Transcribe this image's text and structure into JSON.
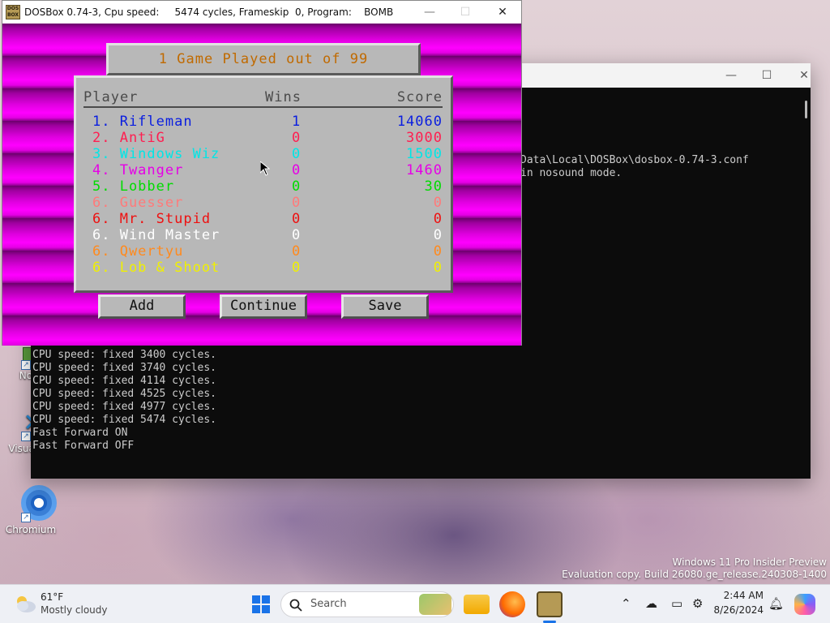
{
  "desktop": {
    "icons": [
      {
        "label": "Note"
      },
      {
        "label": "Visual Co"
      },
      {
        "label": "Chromium"
      }
    ],
    "watermark": {
      "line1": "Windows 11 Pro Insider Preview",
      "line2": "Evaluation copy. Build 26080.ge_release.240308-1400"
    }
  },
  "console": {
    "top_lines": [
      "Data\\Local\\DOSBox\\dosbox-0.74-3.conf",
      "in nosound mode."
    ],
    "lines": [
      "CPU speed: fixed 3400 cycles.",
      "CPU speed: fixed 3740 cycles.",
      "CPU speed: fixed 4114 cycles.",
      "CPU speed: fixed 4525 cycles.",
      "CPU speed: fixed 4977 cycles.",
      "CPU speed: fixed 5474 cycles.",
      "Fast Forward ON",
      "Fast Forward OFF"
    ]
  },
  "dosbox": {
    "title": "DOSBox 0.74-3, Cpu speed:     5474 cycles, Frameskip  0, Program:    BOMB",
    "logo_text": "DOS BOX",
    "game": {
      "header": "1 Game Played out of 99",
      "columns": {
        "player": "Player",
        "wins": "Wins",
        "score": "Score"
      },
      "rows": [
        {
          "player": "1. Rifleman",
          "wins": "1",
          "score": "14060",
          "color": "#0a1ee0"
        },
        {
          "player": "2. AntiG",
          "wins": "0",
          "score": "3000",
          "color": "#ff1e50"
        },
        {
          "player": "3. Windows Wiz",
          "wins": "0",
          "score": "1500",
          "color": "#00e6e6"
        },
        {
          "player": "4. Twanger",
          "wins": "0",
          "score": "1460",
          "color": "#e600e6"
        },
        {
          "player": "5. Lobber",
          "wins": "0",
          "score": "30",
          "color": "#00dc00"
        },
        {
          "player": "6. Guesser",
          "wins": "0",
          "score": "0",
          "color": "#ff7a7a"
        },
        {
          "player": "6. Mr. Stupid",
          "wins": "0",
          "score": "0",
          "color": "#ee1010"
        },
        {
          "player": "6. Wind Master",
          "wins": "0",
          "score": "0",
          "color": "#ffffff"
        },
        {
          "player": "6. Qwertyu",
          "wins": "0",
          "score": "0",
          "color": "#ff8a1e"
        },
        {
          "player": "6. Lob & Shoot",
          "wins": "0",
          "score": "0",
          "color": "#f0f000"
        }
      ],
      "buttons": {
        "add": "Add",
        "continue": "Continue",
        "save": "Save"
      }
    }
  },
  "taskbar": {
    "weather": {
      "temp": "61°F",
      "condition": "Mostly cloudy"
    },
    "search_label": "Search",
    "time": "2:44 AM",
    "date": "8/26/2024"
  }
}
